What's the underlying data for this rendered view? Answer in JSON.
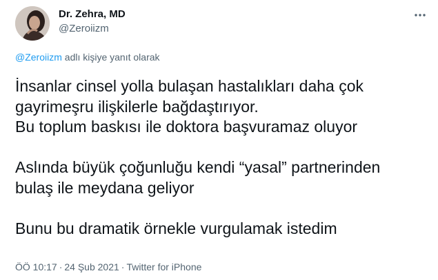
{
  "author": {
    "name": "Dr. Zehra, MD",
    "handle": "@Zeroiizm"
  },
  "more_button": {
    "icon": "more-horizontal-icon"
  },
  "reply_context": {
    "mention": "@Zeroiizm",
    "suffix": " adlı kişiye yanıt olarak"
  },
  "tweet_text": {
    "p1_line1": "İnsanlar cinsel yolla bulaşan hastalıkları daha çok",
    "p1_line2": "gayrimeşru ilişkilerle bağdaştırıyor.",
    "p1_line3": "Bu toplum baskısı ile doktora başvuramaz oluyor",
    "p2_line1": "Aslında büyük çoğunluğu kendi “yasal” partnerinden",
    "p2_line2": "bulaş ile meydana geliyor",
    "p3_line1": "Bunu bu dramatik örnekle vurgulamak istedim"
  },
  "meta": {
    "time": "ÖÖ 10:17",
    "separator": "·",
    "date": "24 Şub 2021",
    "source": "Twitter for iPhone"
  },
  "colors": {
    "link": "#1d9bf0",
    "secondary_text": "#536471",
    "primary_text": "#0f1419"
  }
}
